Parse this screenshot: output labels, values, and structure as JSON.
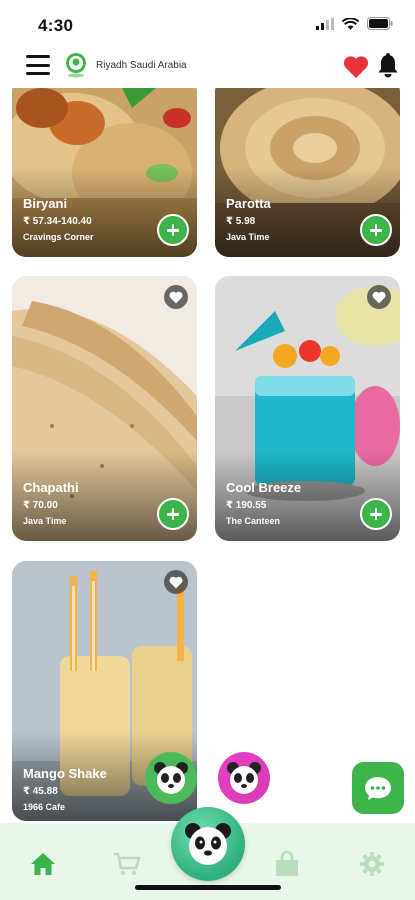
{
  "status_bar": {
    "time": "4:30",
    "icons": [
      "signal-icon",
      "wifi-icon",
      "battery-icon"
    ]
  },
  "header": {
    "location": "Riyadh Saudi Arabia",
    "icons": [
      "menu-icon",
      "location-pin-icon",
      "heart-icon",
      "bell-icon"
    ]
  },
  "products": [
    {
      "name": "Biryani",
      "price": "₹ 57.34-140.40",
      "store": "Cravings Corner"
    },
    {
      "name": "Parotta",
      "price": "₹ 5.98",
      "store": "Java Time"
    },
    {
      "name": "Chapathi",
      "price": "₹ 70.00",
      "store": "Java Time"
    },
    {
      "name": "Cool Breeze",
      "price": "₹ 190.55",
      "store": "The Canteen"
    },
    {
      "name": "Mango Shake",
      "price": "₹ 45.88",
      "store": "1966 Cafe"
    }
  ],
  "bottom_nav": {
    "items": [
      "home-icon",
      "cart-icon",
      "panda-icon",
      "shopping-bag-icon",
      "settings-icon"
    ]
  },
  "colors": {
    "accent": "#3cb44a",
    "nav_background": "#e9f6ea",
    "favorite": "#e8333c",
    "chat_fab": "#3cb44a"
  }
}
